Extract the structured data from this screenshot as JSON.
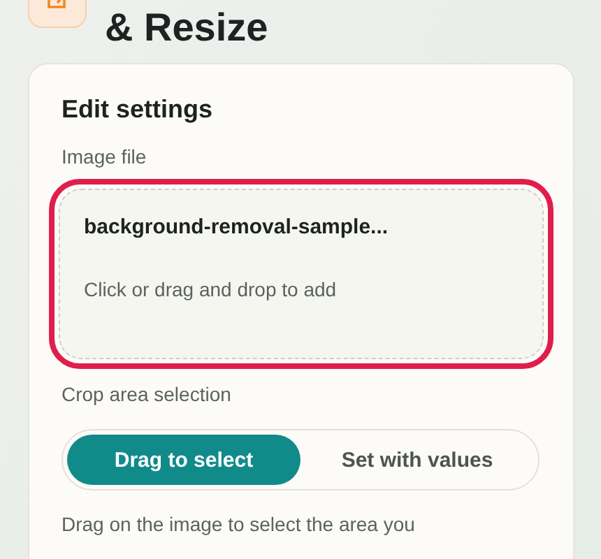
{
  "header": {
    "title_lines": [
      "& Resize"
    ]
  },
  "settings": {
    "heading": "Edit settings",
    "image_file": {
      "label": "Image file",
      "file_name": "background-removal-sample...",
      "hint": "Click or drag and drop to add",
      "highlighted": true
    },
    "crop_area": {
      "label": "Crop area selection",
      "options": [
        {
          "label": "Drag to select",
          "selected": true
        },
        {
          "label": "Set with values",
          "selected": false
        }
      ],
      "description": "Drag on the image to select the area you"
    }
  }
}
